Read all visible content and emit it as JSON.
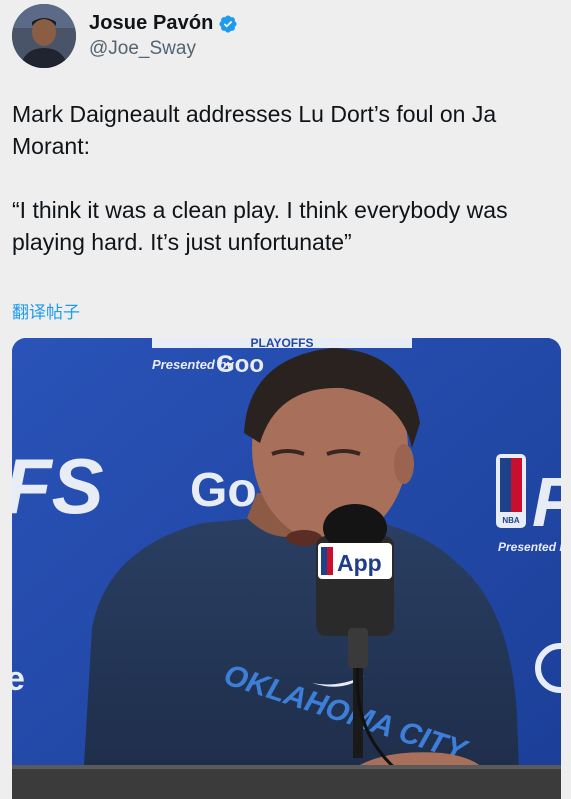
{
  "author": {
    "display_name": "Josue Pavón",
    "handle": "@Joe_Sway",
    "verified": true,
    "verified_color": "#1d9bf0"
  },
  "tweet": {
    "paragraphs": [
      "Mark Daigneault addresses Lu Dort’s foul on Ja Morant:",
      "“I think it was a clean play. I think everybody was playing hard. It’s just unfortunate”"
    ]
  },
  "translate_link": "翻译帖子",
  "media": {
    "backdrop_top_banner": "PLAYOFFS",
    "presented_by_top": "Presented by",
    "sponsor_top": "Goo",
    "sponsor_mid": "Go",
    "side_left": "FS",
    "side_right_logo": "NBA",
    "side_right_letter": "P",
    "presented_by_right": "Presented by",
    "mic_badge": "App",
    "shirt_text": "OKLAHOMA CITY",
    "backdrop_color": "#2247a6"
  }
}
